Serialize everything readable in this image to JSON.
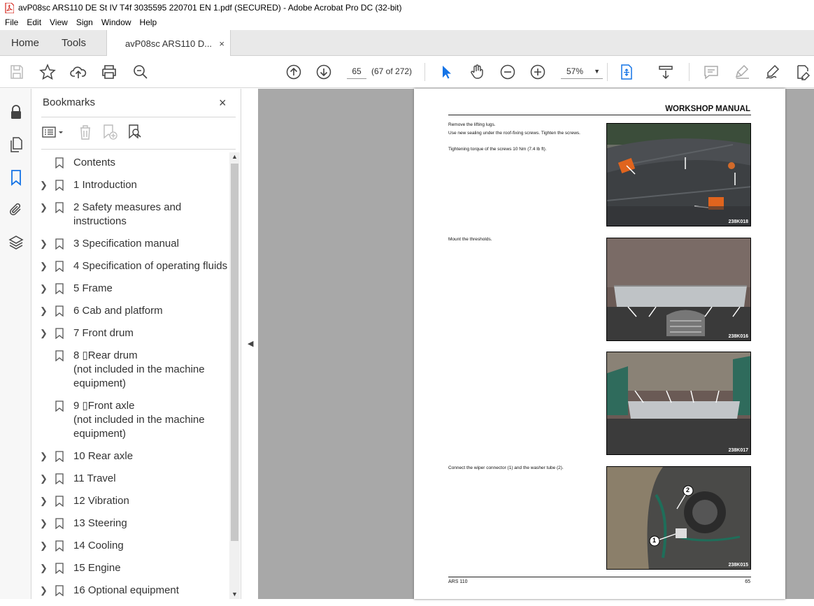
{
  "window": {
    "title": "avP08sc ARS110 DE St IV T4f 3035595 220701 EN 1.pdf (SECURED) - Adobe Acrobat Pro DC (32-bit)"
  },
  "menu": [
    "File",
    "Edit",
    "View",
    "Sign",
    "Window",
    "Help"
  ],
  "tabs": {
    "home": "Home",
    "tools": "Tools",
    "doc": "avP08sc ARS110 D...",
    "doc_close": "×"
  },
  "toolbar": {
    "page_number": "65",
    "page_count": "(67 of 272)",
    "zoom": "57%",
    "icons": [
      "save-icon",
      "star-icon",
      "upload-icon",
      "print-icon",
      "search-zoom-icon",
      "prev-page-icon",
      "next-page-icon",
      "select-cursor-icon",
      "hand-icon",
      "zoom-out-icon",
      "zoom-in-icon",
      "fit-page-icon",
      "scroll-mode-icon",
      "comment-icon",
      "highlight-icon",
      "sign-icon",
      "edit-icon"
    ]
  },
  "left_rail": [
    "lock-icon",
    "pages-icon",
    "bookmark-icon",
    "attachment-icon",
    "layers-icon"
  ],
  "bookmarks_panel": {
    "title": "Bookmarks",
    "close": "×",
    "items": [
      {
        "label": "Contents",
        "expandable": false
      },
      {
        "label": "1 Introduction",
        "expandable": true
      },
      {
        "label": "2 Safety measures and\ninstructions",
        "expandable": true
      },
      {
        "label": "3 Specification manual",
        "expandable": true
      },
      {
        "label": "4 Specification of operating fluids",
        "expandable": true
      },
      {
        "label": "5 Frame",
        "expandable": true
      },
      {
        "label": "6 Cab and platform",
        "expandable": true
      },
      {
        "label": "7 Front drum",
        "expandable": true
      },
      {
        "label": "8 ▯Rear drum\n(not included in the machine\nequipment)",
        "expandable": false
      },
      {
        "label": "9 ▯Front axle\n(not included in the machine\nequipment)",
        "expandable": false
      },
      {
        "label": "10 Rear axle",
        "expandable": true
      },
      {
        "label": "11 Travel",
        "expandable": true
      },
      {
        "label": "12 Vibration",
        "expandable": true
      },
      {
        "label": "13 Steering",
        "expandable": true
      },
      {
        "label": "14 Cooling",
        "expandable": true
      },
      {
        "label": "15 Engine",
        "expandable": true
      },
      {
        "label": "16 Optional equipment",
        "expandable": true
      }
    ]
  },
  "document_page": {
    "header": "WORKSHOP MANUAL",
    "text_blocks": [
      "Remove the lifting lugs.",
      "Use new sealing under the roof-fixing screws. Tighten the screws.",
      "Tightening torque of the screws 10 Nm (7.4 lb ft).",
      "Mount the thresholds.",
      "Connect the wiper connector (1) and the washer tube (2)."
    ],
    "photo_codes": [
      "238K018",
      "238K016",
      "238K017",
      "238K015"
    ],
    "callouts": [
      "1",
      "2"
    ],
    "footer_left": "ARS 110",
    "footer_right": "65"
  }
}
